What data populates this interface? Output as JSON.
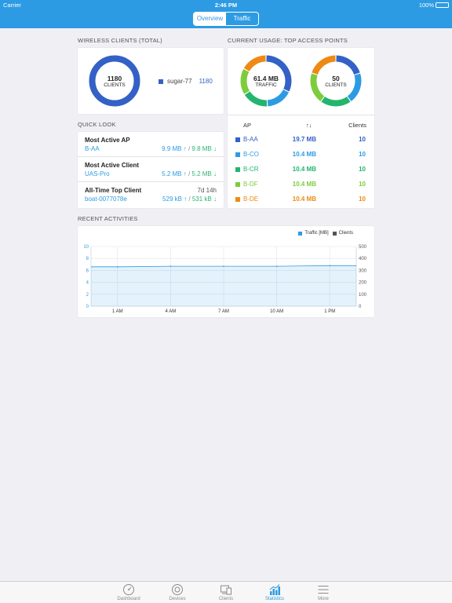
{
  "status_bar": {
    "carrier": "Carrier",
    "time": "2:46 PM",
    "battery": "100%"
  },
  "segmented": {
    "overview": "Overview",
    "traffic": "Traffic"
  },
  "wireless_clients": {
    "title": "WIRELESS CLIENTS (TOTAL)",
    "donut_value": "1180",
    "donut_unit": "CLIENTS",
    "legend_name": "sugar-77",
    "legend_value": "1180",
    "color": "#3361c6"
  },
  "current_usage": {
    "title": "CURRENT USAGE: TOP ACCESS POINTS",
    "traffic_value": "61.4 MB",
    "traffic_unit": "TRAFFIC",
    "clients_value": "50",
    "clients_unit": "CLIENTS",
    "col_ap": "AP",
    "col_sort": "↑↓",
    "col_clients": "Clients",
    "rows": [
      {
        "name": "B-AA",
        "traffic": "19.7 MB",
        "clients": "10",
        "color": "#3361c6",
        "traffic_mb": 19.7,
        "clients_n": 10
      },
      {
        "name": "B-CO",
        "traffic": "10.4 MB",
        "clients": "10",
        "color": "#2d9be3",
        "traffic_mb": 10.4,
        "clients_n": 10
      },
      {
        "name": "B-CR",
        "traffic": "10.4 MB",
        "clients": "10",
        "color": "#23b56d",
        "traffic_mb": 10.4,
        "clients_n": 10
      },
      {
        "name": "B-DF",
        "traffic": "10.4 MB",
        "clients": "10",
        "color": "#7dcc3c",
        "traffic_mb": 10.4,
        "clients_n": 10
      },
      {
        "name": "B-DE",
        "traffic": "10.4 MB",
        "clients": "10",
        "color": "#ee8a14",
        "traffic_mb": 10.4,
        "clients_n": 10
      }
    ]
  },
  "quick_look": {
    "title": "QUICK LOOK",
    "most_active_ap": {
      "label": "Most Active AP",
      "name": "B-AA",
      "up": "9.9 MB ↑",
      "sep": " / ",
      "down": "9.8 MB ↓"
    },
    "most_active_client": {
      "label": "Most Active Client",
      "name": "UAS-Pro",
      "up": "5.2 MB ↑",
      "sep": " / ",
      "down": "5.2 MB ↓"
    },
    "all_time_top_client": {
      "label": "All-Time Top Client",
      "duration": "7d 14h",
      "name": "boat-0077078e",
      "up": "529 kB ↑",
      "sep": " / ",
      "down": "531 kB ↓"
    }
  },
  "recent_activities": {
    "title": "RECENT ACTIVITIES",
    "legend_traffic": "Traffic [MB]",
    "legend_clients": "Clients",
    "traffic_color": "#2d9be3",
    "clients_color": "#555555"
  },
  "chart_data": {
    "type": "area",
    "x": [
      "1 AM",
      "4 AM",
      "7 AM",
      "10 AM",
      "1 PM"
    ],
    "xlabel": "",
    "ylabel": "",
    "ylim": [
      0,
      10
    ],
    "y2lim": [
      0,
      500
    ],
    "y_ticks": [
      "0",
      "2",
      "4",
      "6",
      "8",
      "10"
    ],
    "y2_ticks": [
      "0",
      "100",
      "200",
      "300",
      "400",
      "500"
    ],
    "grid": true,
    "legend": "top-right",
    "series": [
      {
        "name": "Traffic [MB]",
        "axis": "left",
        "values": [
          6.6,
          6.7,
          6.7,
          6.7,
          6.8
        ],
        "color": "#2d9be3"
      }
    ]
  },
  "tab_bar": {
    "items": [
      {
        "label": "Dashboard",
        "icon": "dashboard-icon"
      },
      {
        "label": "Devices",
        "icon": "devices-icon"
      },
      {
        "label": "Clients",
        "icon": "clients-icon"
      },
      {
        "label": "Statistics",
        "icon": "statistics-icon"
      },
      {
        "label": "More",
        "icon": "more-icon"
      }
    ],
    "active_color": "#2d9be3"
  }
}
